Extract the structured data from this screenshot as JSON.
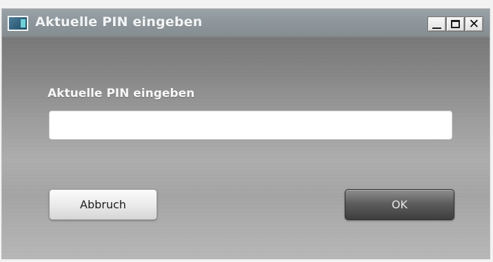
{
  "window": {
    "title": "Aktuelle PIN eingeben",
    "icon": "app-window-icon",
    "controls": {
      "minimize": "minimize-icon",
      "maximize": "maximize-icon",
      "close_glyph": "✕"
    }
  },
  "dialog": {
    "prompt_label": "Aktuelle PIN eingeben",
    "pin_input": {
      "value": "",
      "placeholder": ""
    },
    "buttons": {
      "cancel_label": "Abbruch",
      "ok_label": "OK"
    }
  },
  "colors": {
    "titlebar": "#8e979c",
    "title_text": "#f3f4f5",
    "label_text": "#f7f7f7",
    "ok_button": "#4a4a4a",
    "cancel_button": "#e8e8e8"
  }
}
